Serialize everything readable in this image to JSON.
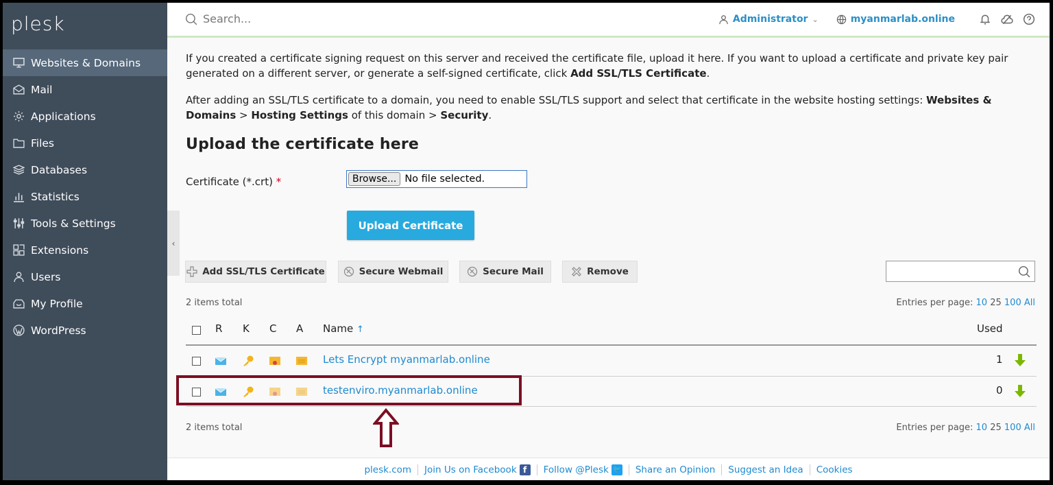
{
  "sidebar": {
    "logo": "plesk",
    "items": [
      {
        "label": "Websites & Domains",
        "icon": "monitor-icon"
      },
      {
        "label": "Mail",
        "icon": "mail-icon"
      },
      {
        "label": "Applications",
        "icon": "gear-icon"
      },
      {
        "label": "Files",
        "icon": "folder-icon"
      },
      {
        "label": "Databases",
        "icon": "database-icon"
      },
      {
        "label": "Statistics",
        "icon": "bar-chart-icon"
      },
      {
        "label": "Tools & Settings",
        "icon": "sliders-icon"
      },
      {
        "label": "Extensions",
        "icon": "blocks-icon"
      },
      {
        "label": "Users",
        "icon": "user-icon"
      },
      {
        "label": "My Profile",
        "icon": "profile-icon"
      },
      {
        "label": "WordPress",
        "icon": "wordpress-icon"
      }
    ]
  },
  "header": {
    "search_placeholder": "Search...",
    "user": "Administrator",
    "domain": "myanmarlab.online"
  },
  "intro": {
    "p1_a": "If you created a certificate signing request on this server and received the certificate file, upload it here. If you want to upload a certificate and private key pair generated on a different server, or generate a self-signed certificate, click ",
    "p1_b": "Add SSL/TLS Certificate",
    "p1_c": ".",
    "p2_a": "After adding an SSL/TLS certificate to a domain, you need to enable SSL/TLS support and select that certificate in the website hosting settings: ",
    "p2_b": "Websites & Domains",
    "p2_c": " > ",
    "p2_d": "Hosting Settings",
    "p2_e": " of this domain > ",
    "p2_f": "Security",
    "p2_g": "."
  },
  "upload": {
    "heading": "Upload the certificate here",
    "label": "Certificate (*.crt)",
    "required_mark": "*",
    "browse": "Browse...",
    "file_status": "No file selected.",
    "button": "Upload Certificate"
  },
  "toolbar": {
    "add": "Add SSL/TLS Certificate",
    "webmail": "Secure Webmail",
    "mail": "Secure Mail",
    "remove": "Remove"
  },
  "list": {
    "total": "2 items total",
    "entries_label": "Entries per page:",
    "entries_options": [
      "10",
      "25",
      "100",
      "All"
    ],
    "columns": {
      "r": "R",
      "k": "K",
      "c": "C",
      "a": "A",
      "name": "Name",
      "sort": "↑",
      "used": "Used"
    },
    "rows": [
      {
        "name": "Lets Encrypt myanmarlab.online",
        "used": "1"
      },
      {
        "name": "testenviro.myanmarlab.online",
        "used": "0"
      }
    ]
  },
  "footer": {
    "links": [
      "plesk.com",
      "Join Us on Facebook",
      "Follow @Plesk",
      "Share an Opinion",
      "Suggest an Idea",
      "Cookies"
    ]
  },
  "colors": {
    "sidebar": "#3f4c5a",
    "accent": "#28aade",
    "link": "#1e8ad0",
    "highlight": "#7b0f24"
  }
}
